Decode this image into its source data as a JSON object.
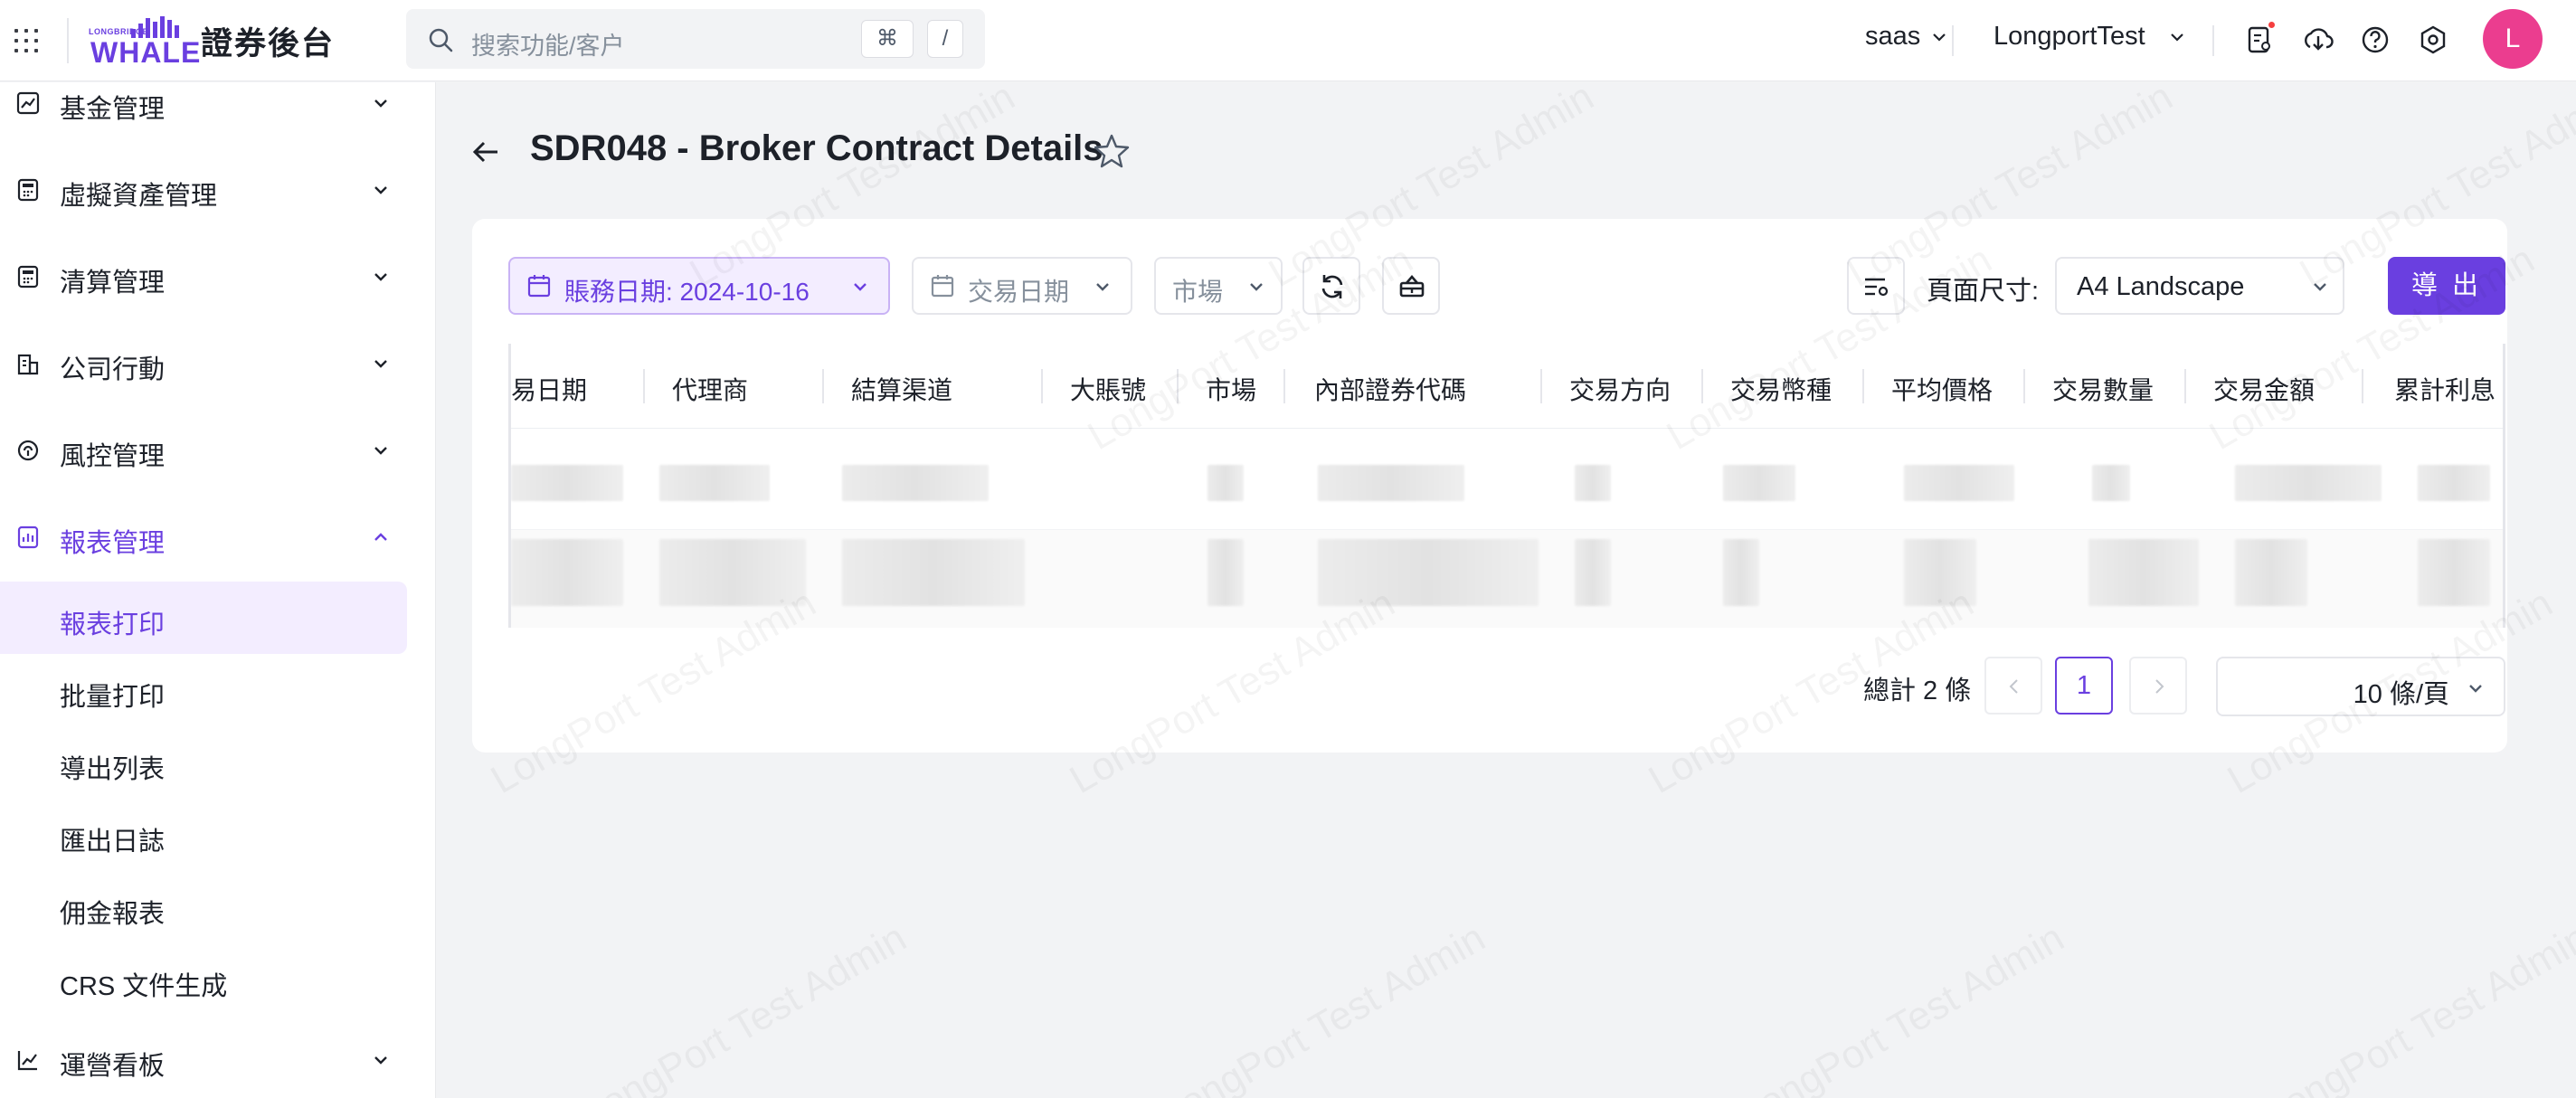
{
  "header": {
    "brand_small": "LONGBRIDGE",
    "brand_logo": "WHALE",
    "app_title": "證券後台",
    "search_placeholder": "搜索功能/客户",
    "shortcut_cmd": "⌘",
    "shortcut_key": "/",
    "tenant": "saas",
    "account": "LongportTest",
    "avatar_letter": "L",
    "icons": [
      "task-list-icon",
      "download-icon",
      "help-icon",
      "settings-icon"
    ]
  },
  "sidebar": {
    "items": [
      {
        "label": "基金管理",
        "icon": "chart-icon",
        "expanded": false
      },
      {
        "label": "虛擬資產管理",
        "icon": "calculator-icon",
        "expanded": false
      },
      {
        "label": "清算管理",
        "icon": "calculator-icon",
        "expanded": false
      },
      {
        "label": "公司行動",
        "icon": "building-icon",
        "expanded": false
      },
      {
        "label": "風控管理",
        "icon": "shield-icon",
        "expanded": false
      },
      {
        "label": "報表管理",
        "icon": "report-icon",
        "expanded": true
      },
      {
        "label": "運營看板",
        "icon": "chart-icon",
        "expanded": false
      }
    ],
    "sub_items": [
      "報表打印",
      "批量打印",
      "導出列表",
      "匯出日誌",
      "佣金報表",
      "CRS 文件生成"
    ],
    "active_sub": "報表打印"
  },
  "page": {
    "title": "SDR048 - Broker Contract Details"
  },
  "filters": {
    "accounting_date": "賬務日期: 2024-10-16",
    "trade_date_placeholder": "交易日期",
    "market_placeholder": "市場",
    "page_size_label": "頁面尺寸:",
    "page_size_value": "A4 Landscape",
    "export_label": "導 出"
  },
  "table": {
    "columns": [
      "易日期",
      "代理商",
      "結算渠道",
      "大賬號",
      "市場",
      "內部證券代碼",
      "交易方向",
      "交易幣種",
      "平均價格",
      "交易數量",
      "交易金額",
      "累計利息"
    ],
    "row_count": 2
  },
  "pagination": {
    "total": "總計 2 條",
    "current_page": "1",
    "page_size": "10 條/頁"
  },
  "watermark_text": "LongPort Test Admin",
  "colors": {
    "accent": "#6a3fe0",
    "avatar": "#eb3d8f",
    "active_bg": "#f3edff"
  }
}
